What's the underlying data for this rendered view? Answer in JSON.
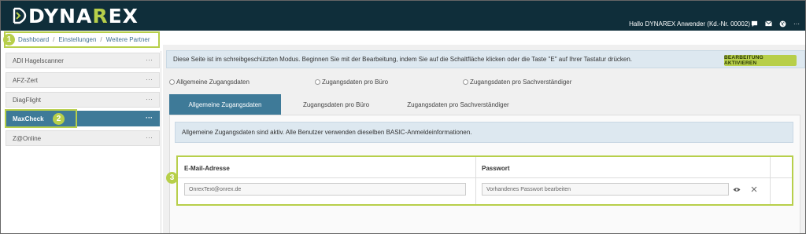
{
  "header": {
    "logo_prefix": "DYNA",
    "logo_x": "R",
    "logo_suffix": "EX",
    "user_info": "Hallo DYNAREX Anwender (Kd.-Nr. 00002)",
    "icons": [
      "chat-icon",
      "mail-icon",
      "globe-icon",
      "more-icon"
    ],
    "icon_glyphs": {
      "more": "···"
    }
  },
  "breadcrumb": [
    "Dashboard",
    "Einstellungen",
    "Weitere Partner"
  ],
  "breadcrumb_sep": "/",
  "badges": [
    "1",
    "2",
    "3"
  ],
  "sidebar": {
    "items": [
      {
        "label": "ADI Hagelscanner",
        "more": "···"
      },
      {
        "label": "AFZ-Zert",
        "more": "···"
      },
      {
        "label": "DiagFlight",
        "more": "···"
      },
      {
        "label": "MaxCheck",
        "more": "···",
        "active": true
      },
      {
        "label": "Z@Online",
        "more": "···"
      }
    ]
  },
  "main": {
    "notice": "Diese Seite ist im schreibgeschützten Modus. Beginnen Sie mit der Bearbeitung, indem Sie auf die Schaltfläche klicken oder die Taste \"E\" auf Ihrer Tastatur drücken.",
    "edit_button": "BEARBEITUNG AKTIVIEREN",
    "radios": [
      "Allgemeine Zugangsdaten",
      "Zugangsdaten pro Büro",
      "Zugangsdaten pro Sachverständiger"
    ],
    "tabs": [
      "Allgemeine Zugangsdaten",
      "Zugangsdaten pro Büro",
      "Zugangsdaten pro Sachverständiger"
    ],
    "info": "Allgemeine Zugangsdaten sind aktiv.  Alle Benutzer verwenden dieselben BASIC-Anmeldeinformationen.",
    "table": {
      "col_email": "E-Mail-Adresse",
      "col_password": "Passwort",
      "email_value": "OnrexText@onrex.de",
      "password_placeholder": "Vorhandenes Passwort bearbeiten"
    }
  },
  "colors": {
    "header_bg": "#0f2e3a",
    "accent_green": "#b7cf4a",
    "active_blue": "#3e7a98",
    "notice_bg": "#dde8f0"
  }
}
